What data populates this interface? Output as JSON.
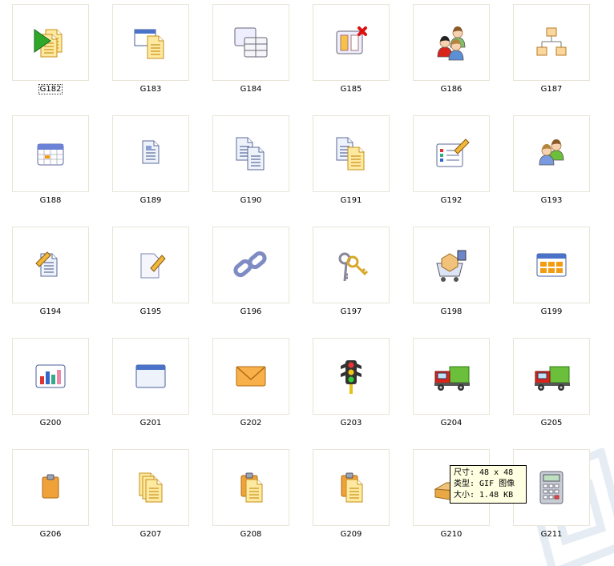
{
  "icons": [
    {
      "label": "G182",
      "icon": "play-document-icon"
    },
    {
      "label": "G183",
      "icon": "window-documents-icon"
    },
    {
      "label": "G184",
      "icon": "table-copy-icon"
    },
    {
      "label": "G185",
      "icon": "columns-delete-icon"
    },
    {
      "label": "G186",
      "icon": "users-group-icon"
    },
    {
      "label": "G187",
      "icon": "hierarchy-icon"
    },
    {
      "label": "G188",
      "icon": "calendar-icon"
    },
    {
      "label": "G189",
      "icon": "document-icon"
    },
    {
      "label": "G190",
      "icon": "documents-copy-icon"
    },
    {
      "label": "G191",
      "icon": "documents-copy-yellow-icon"
    },
    {
      "label": "G192",
      "icon": "form-edit-icon"
    },
    {
      "label": "G193",
      "icon": "two-users-icon"
    },
    {
      "label": "G194",
      "icon": "document-edit-icon"
    },
    {
      "label": "G195",
      "icon": "blank-edit-icon"
    },
    {
      "label": "G196",
      "icon": "link-icon"
    },
    {
      "label": "G197",
      "icon": "keys-icon"
    },
    {
      "label": "G198",
      "icon": "cart-box-icon"
    },
    {
      "label": "G199",
      "icon": "window-grid-icon"
    },
    {
      "label": "G200",
      "icon": "bar-chart-icon"
    },
    {
      "label": "G201",
      "icon": "window-icon"
    },
    {
      "label": "G202",
      "icon": "envelope-icon"
    },
    {
      "label": "G203",
      "icon": "traffic-light-icon"
    },
    {
      "label": "G204",
      "icon": "truck-icon"
    },
    {
      "label": "G205",
      "icon": "truck-icon"
    },
    {
      "label": "G206",
      "icon": "clipboard-icon"
    },
    {
      "label": "G207",
      "icon": "documents-stack-icon"
    },
    {
      "label": "G208",
      "icon": "clipboard-documents-icon"
    },
    {
      "label": "G209",
      "icon": "clipboard-documents-icon"
    },
    {
      "label": "G210",
      "icon": "open-box-icon"
    },
    {
      "label": "G211",
      "icon": "calculator-icon"
    }
  ],
  "selected_label": "G182",
  "tooltip": {
    "size_line": "尺寸: 48 x 48",
    "type_line": "类型: GIF 图像",
    "filesize_line": "大小: 1.48 KB"
  },
  "colors": {
    "thumb_border": "#e9e4d7",
    "tooltip_bg": "#ffffe1"
  }
}
